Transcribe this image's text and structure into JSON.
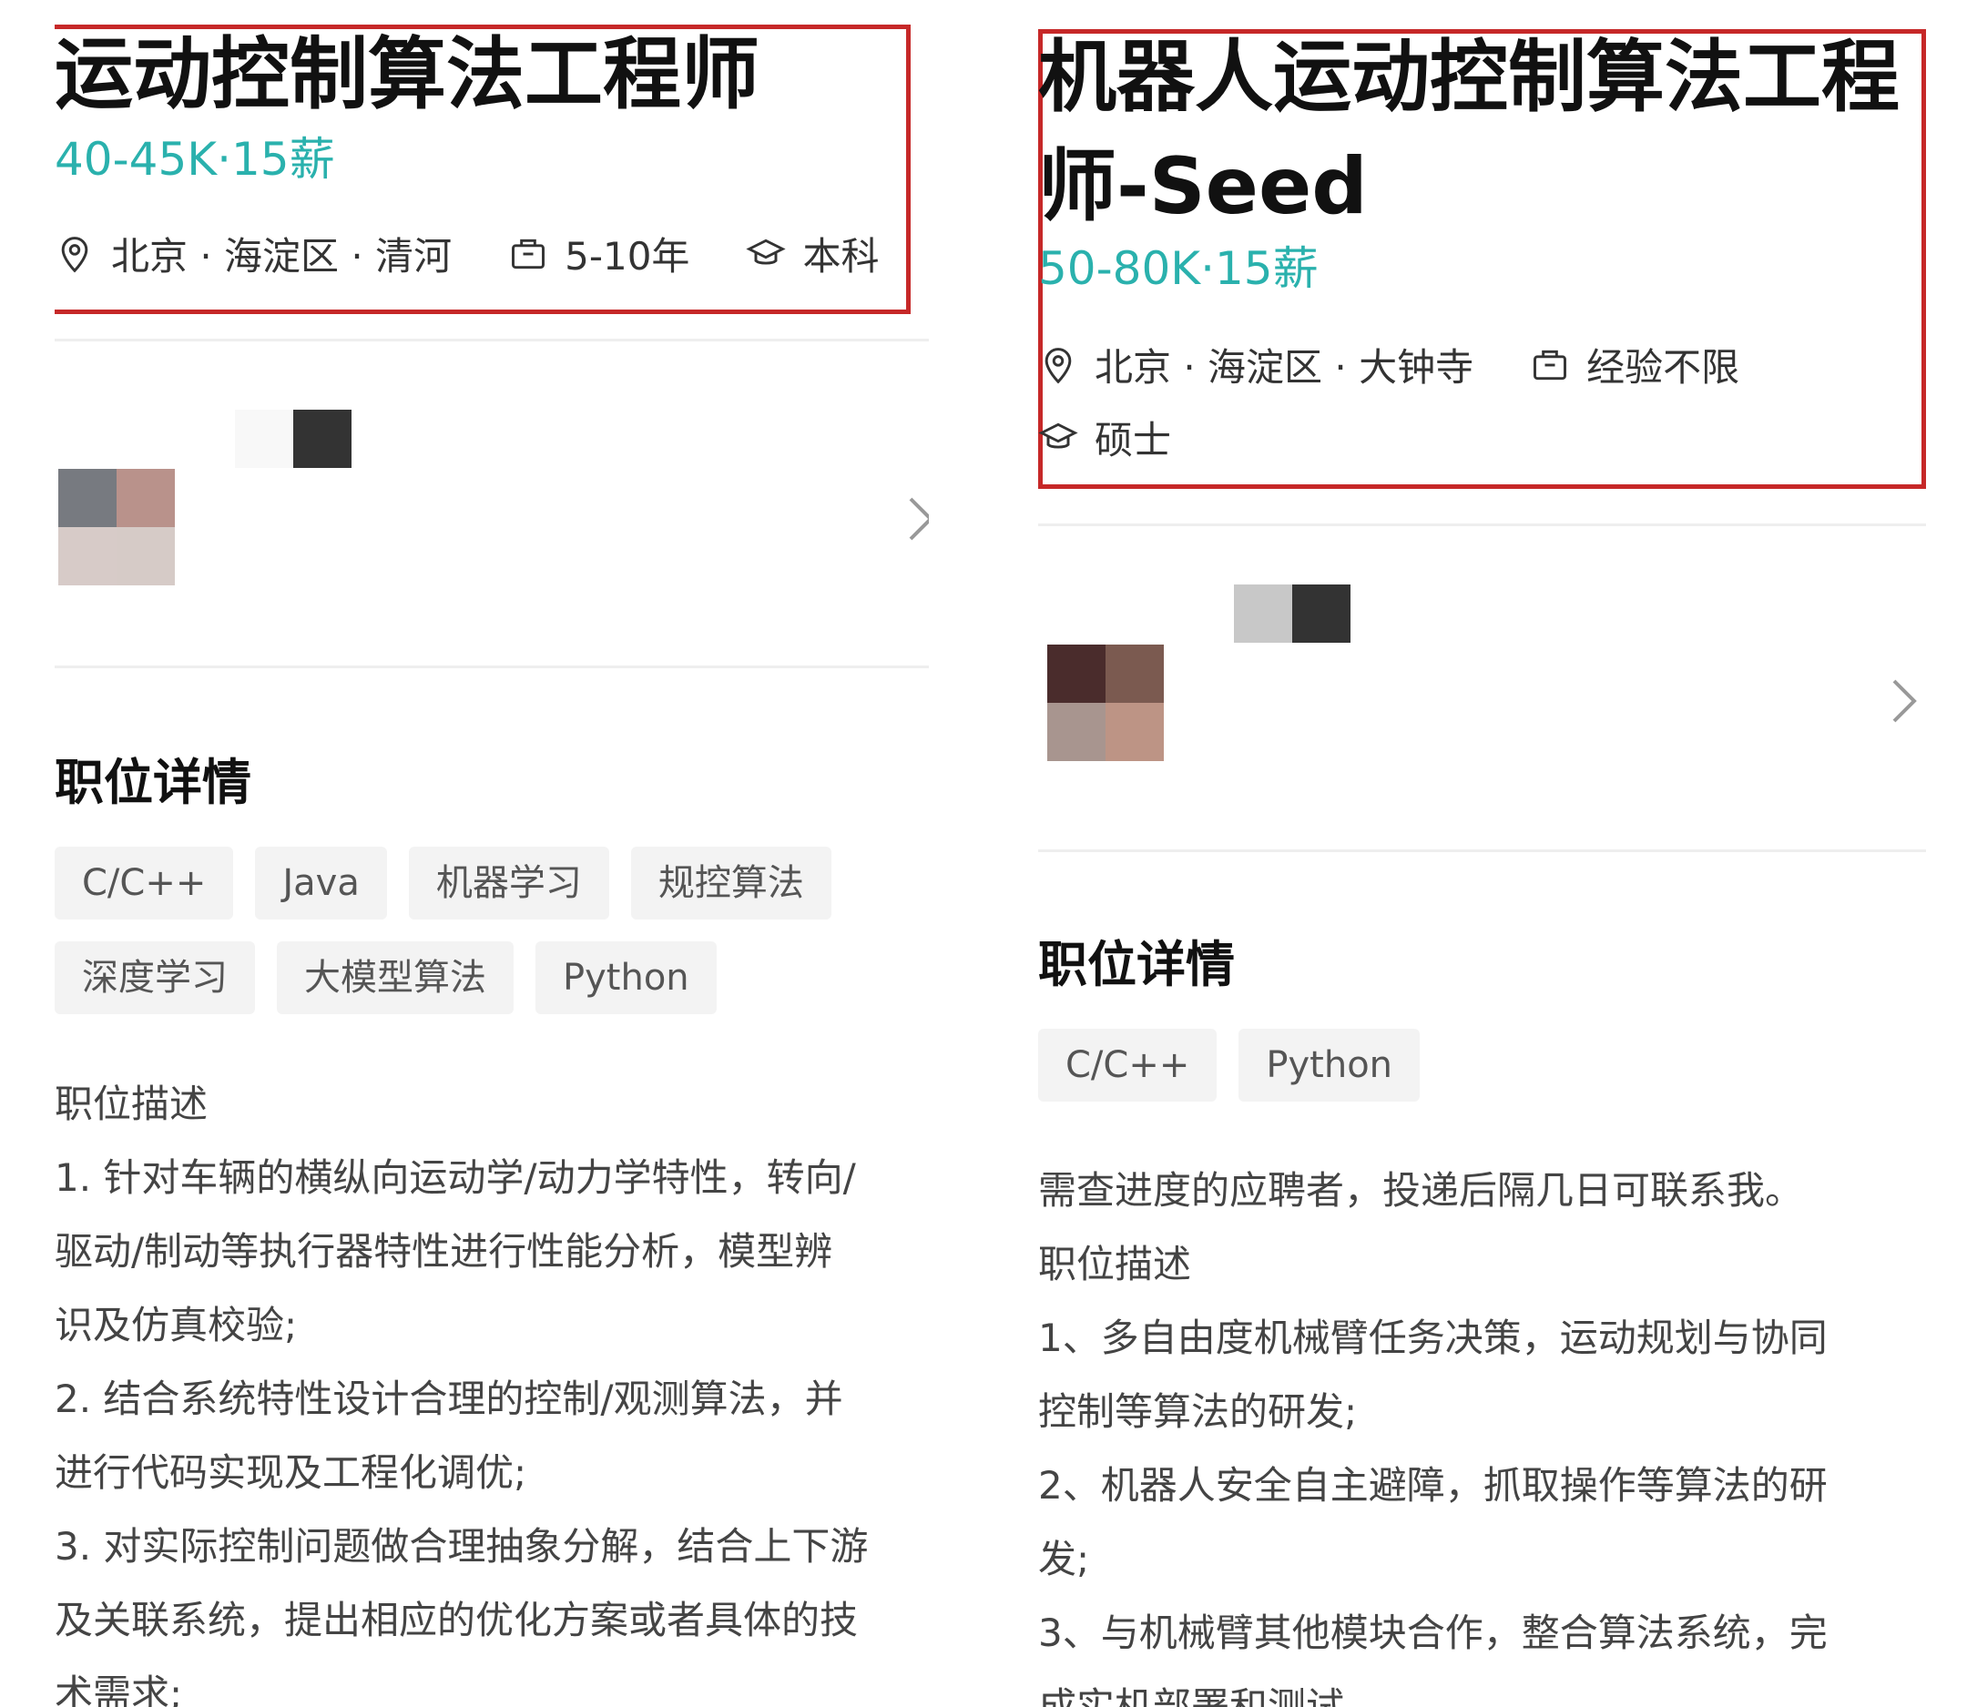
{
  "left": {
    "title": "运动控制算法工程师",
    "salary": "40-45K·15薪",
    "location": "北京 · 海淀区 · 清河",
    "experience": "5-10年",
    "education": "本科",
    "section_title": "职位详情",
    "tags": [
      "C/C++",
      "Java",
      "机器学习",
      "规控算法",
      "深度学习",
      "大模型算法",
      "Python"
    ],
    "description": [
      "职位描述",
      "1. 针对车辆的横纵向运动学/动力学特性，转向/",
      "驱动/制动等执行器特性进行性能分析，模型辨",
      "识及仿真校验;",
      "2. 结合系统特性设计合理的控制/观测算法，并",
      "进行代码实现及工程化调优;",
      "3. 对实际控制问题做合理抽象分解，结合上下游",
      "及关联系统，提出相应的优化方案或者具体的技",
      "术需求;"
    ],
    "logo_colors": [
      "#777a80",
      "#b9928b",
      "#d7cbc8",
      "#d6cbc7"
    ],
    "name_blur_colors": [
      "#f8f8f8",
      "#333333"
    ]
  },
  "right": {
    "title_line1": "机器人运动控制算法工程",
    "title_line2": "师-Seed",
    "salary": "50-80K·15薪",
    "location": "北京 · 海淀区 · 大钟寺",
    "experience": "经验不限",
    "education": "硕士",
    "section_title": "职位详情",
    "tags": [
      "C/C++",
      "Python"
    ],
    "description": [
      "需查进度的应聘者，投递后隔几日可联系我。",
      "职位描述",
      "1、多自由度机械臂任务决策，运动规划与协同",
      "控制等算法的研发;",
      "2、机器人安全自主避障，抓取操作等算法的研",
      "发;",
      "3、与机械臂其他模块合作，整合算法系统，完",
      "成实机部署和测试。"
    ],
    "logo_colors": [
      "#4a2c2c",
      "#7b5a50",
      "#a8958f",
      "#bd9485"
    ],
    "name_blur_colors": [
      "#c8c8c8",
      "#333333"
    ]
  },
  "colors": {
    "accent": "#2ab1ad",
    "highlight_border": "#c62828",
    "tag_bg": "#f3f3f3"
  },
  "icons": [
    "location-pin-icon",
    "briefcase-icon",
    "graduation-cap-icon",
    "chevron-right-icon"
  ]
}
